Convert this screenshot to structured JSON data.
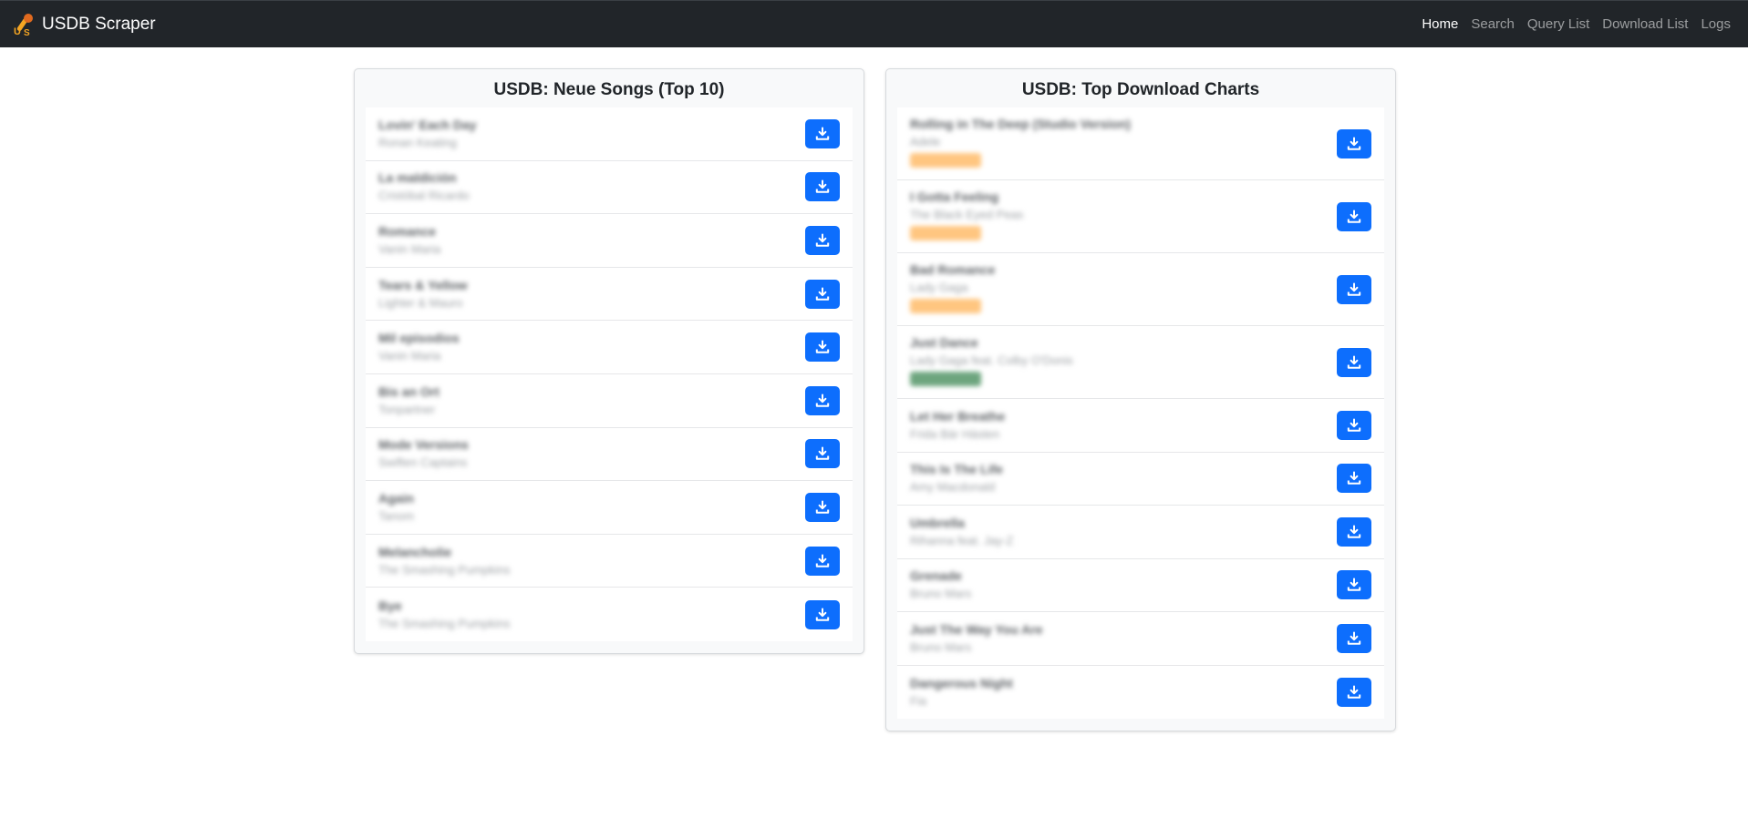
{
  "navbar": {
    "brand": "USDB Scraper",
    "links": [
      {
        "label": "Home",
        "active": true
      },
      {
        "label": "Search",
        "active": false
      },
      {
        "label": "Query List",
        "active": false
      },
      {
        "label": "Download List",
        "active": false
      },
      {
        "label": "Logs",
        "active": false
      }
    ]
  },
  "new_songs": {
    "title": "USDB: Neue Songs (Top 10)",
    "items": [
      {
        "title": "Lovin' Each Day",
        "artist": "Ronan Keating"
      },
      {
        "title": "La maldición",
        "artist": "Cristóbal Ricardo"
      },
      {
        "title": "Romance",
        "artist": "Vanin Maria"
      },
      {
        "title": "Tears & Yellow",
        "artist": "Lighter & Mauro"
      },
      {
        "title": "Mil episodios",
        "artist": "Vanin Maria"
      },
      {
        "title": "Bis an Ort",
        "artist": "Tonpartner"
      },
      {
        "title": "Mode Versions",
        "artist": "Swiften Captains"
      },
      {
        "title": "Again",
        "artist": "Tanom"
      },
      {
        "title": "Melancholie",
        "artist": "The Smashing Pumpkins"
      },
      {
        "title": "Bye",
        "artist": "The Smashing Pumpkins"
      }
    ]
  },
  "top_charts": {
    "title": "USDB: Top Download Charts",
    "items": [
      {
        "title": "Rolling in The Deep (Studio Version)",
        "artist": "Adele",
        "badge_color": "#ffc680"
      },
      {
        "title": "I Gotta Feeling",
        "artist": "The Black Eyed Peas",
        "badge_color": "#ffc680"
      },
      {
        "title": "Bad Romance",
        "artist": "Lady Gaga",
        "badge_color": "#ffc680"
      },
      {
        "title": "Just Dance",
        "artist": "Lady Gaga feat. Colby O'Donis",
        "badge_color": "#6da57e"
      },
      {
        "title": "Let Her Breathe",
        "artist": "Frida Bär Hästen"
      },
      {
        "title": "This Is The Life",
        "artist": "Amy Macdonald"
      },
      {
        "title": "Umbrella",
        "artist": "Rihanna feat. Jay-Z"
      },
      {
        "title": "Grenade",
        "artist": "Bruno Mars"
      },
      {
        "title": "Just The Way You Are",
        "artist": "Bruno Mars"
      },
      {
        "title": "Dangerous Night",
        "artist": "Fia"
      }
    ]
  },
  "icons": {
    "brand_logo": "microphone-logo-icon",
    "download": "download-icon"
  },
  "colors": {
    "navbar_bg": "#212529",
    "primary": "#0d6efd",
    "card_bg": "#f8f9fa"
  }
}
